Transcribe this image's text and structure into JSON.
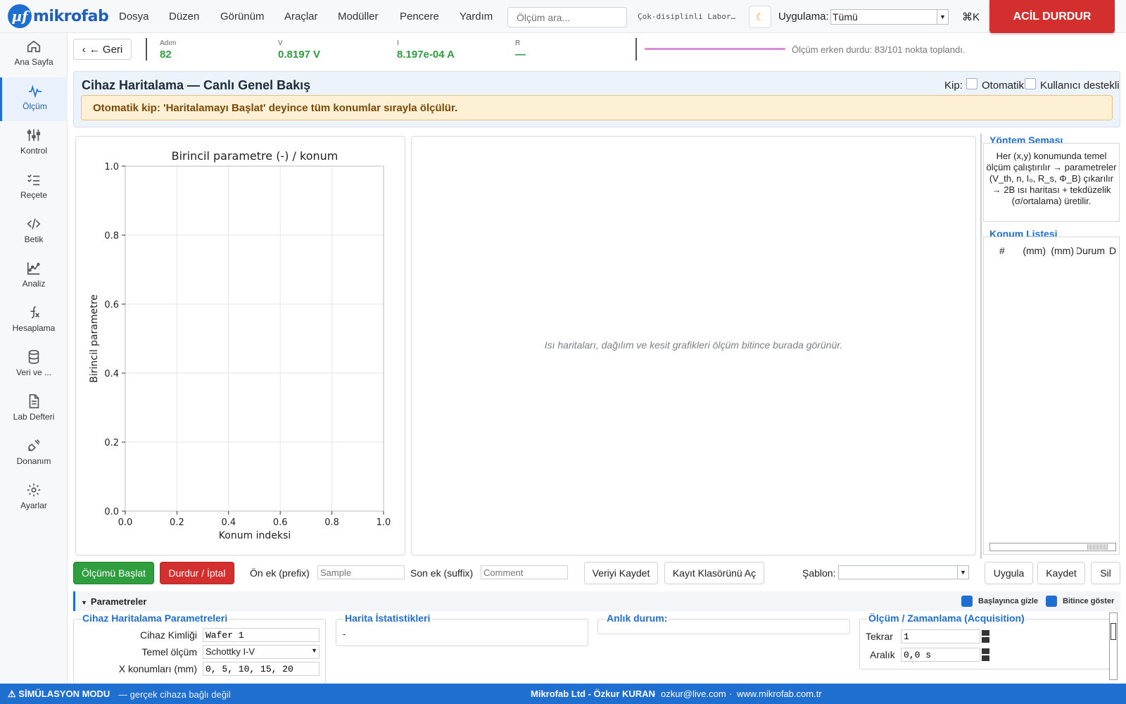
{
  "app": {
    "logo_glyph": "µf",
    "name": "mikrofab"
  },
  "menu": [
    "Dosya",
    "Düzen",
    "Görünüm",
    "Araçlar",
    "Modüller",
    "Pencere",
    "Yardım"
  ],
  "search": {
    "placeholder": "Ölçüm ara..."
  },
  "lab_name": "Çok-disiplinli Labor…",
  "app_selector": {
    "label": "Uygulama:",
    "value": "Tümü"
  },
  "shortcut": "⌘K",
  "emergency_stop": "ACİL DURDUR",
  "sidebar": {
    "items": [
      {
        "label": "Ana Sayfa",
        "icon": "home-icon"
      },
      {
        "label": "Ölçüm",
        "icon": "waveform-icon",
        "active": true
      },
      {
        "label": "Kontrol",
        "icon": "sliders-icon"
      },
      {
        "label": "Reçete",
        "icon": "checklist-icon"
      },
      {
        "label": "Betik",
        "icon": "code-icon"
      },
      {
        "label": "Analiz",
        "icon": "chart-icon"
      },
      {
        "label": "Hesaplama",
        "icon": "function-icon"
      },
      {
        "label": "Veri ve ...",
        "icon": "database-icon"
      },
      {
        "label": "Lab Defteri",
        "icon": "document-icon"
      },
      {
        "label": "Donanım",
        "icon": "plug-icon"
      },
      {
        "label": "Ayarlar",
        "icon": "gear-icon"
      }
    ]
  },
  "status": {
    "back_label": "← Geri",
    "step_label": "Adım",
    "step_value": "82",
    "v_label": "V",
    "v_value": "0.8197 V",
    "i_label": "I",
    "i_value": "8.197e-04 A",
    "r_label": "R",
    "r_value": "—",
    "progress_message": "Ölçüm erken durdu: 83/101 nokta toplandı."
  },
  "header": {
    "title": "Cihaz Haritalama — Canlı Genel Bakış",
    "mode_label": "Kip:",
    "mode_auto": "Otomatik",
    "mode_user": "Kullanıcı destekli",
    "warning": "Otomatik kip: 'Haritalamayı Başlat' deyince tüm konumlar sırayla ölçülür."
  },
  "chart_data": {
    "type": "line",
    "title": "Birincil parametre (-) / konum",
    "xlabel": "Konum indeksi",
    "ylabel": "Birincil parametre",
    "xlim": [
      0.0,
      1.0
    ],
    "ylim": [
      0.0,
      1.0
    ],
    "x_ticks": [
      "0.0",
      "0.2",
      "0.4",
      "0.6",
      "0.8",
      "1.0"
    ],
    "y_ticks": [
      "0.0",
      "0.2",
      "0.4",
      "0.6",
      "0.8",
      "1.0"
    ],
    "grid": true,
    "series": []
  },
  "maps_placeholder": "Isı haritaları, dağılım ve kesit grafikleri ölçüm bitince burada görünür.",
  "method": {
    "title": "Yöntem Şeması",
    "text": "Her (x,y) konumunda temel ölçüm çalıştırılır → parametreler (V_th, n, I₀, R_s, Φ_B) çıkarılır → 2B ısı haritası + tekdüzelik (σ/ortalama) üretilir."
  },
  "location_list": {
    "title": "Konum Listesi",
    "columns": [
      "#",
      "X (mm)",
      "Y (mm)",
      "Durum",
      "D"
    ]
  },
  "actions": {
    "start": "Ölçümü Başlat",
    "stop": "Durdur / İptal",
    "prefix_label": "Ön ek (prefix)",
    "prefix_placeholder": "Sample",
    "suffix_label": "Son ek (suffix)",
    "suffix_placeholder": "Comment",
    "save": "Veriyi Kaydet",
    "open_folder": "Kayıt Klasörünü Aç",
    "template_label": "Şablon:",
    "template_value": "",
    "apply": "Uygula",
    "save_template": "Kaydet",
    "delete": "Sil"
  },
  "params": {
    "bar_title": "Parametreler",
    "hide_on_start": "Başlayınca gizle",
    "show_on_finish": "Bitince göster",
    "device_group": {
      "title": "Cihaz Haritalama Parametreleri",
      "device_id_label": "Cihaz Kimliği",
      "device_id": "Wafer 1",
      "base_label": "Temel ölçüm",
      "base_value": "Schottky I-V",
      "x_label": "X konumları (mm)",
      "x_value": "0, 5, 10, 15, 20"
    },
    "map_stats": {
      "title": "Harita İstatistikleri",
      "value": "-"
    },
    "instant": {
      "title": "Anlık durum:"
    },
    "acquisition": {
      "title": "Ölçüm / Zamanlama (Acquisition)",
      "repeat_label": "Tekrar",
      "repeat_value": "1",
      "interval_label": "Aralık",
      "interval_value": "0,0 s"
    }
  },
  "footer": {
    "sim_mode": "SİMÜLASYON MODU",
    "sim_note": "— gerçek cihaza bağlı değil",
    "company": "Mikrofab Ltd - Özkur KURAN",
    "email": "ozkur@live.com",
    "web": "www.mikrofab.com.tr",
    "sep": "·"
  },
  "colors": {
    "accent": "#1f6fd1",
    "danger": "#d32f2f",
    "success": "#2e9e3e",
    "warn_bg": "#fdf0d5"
  }
}
